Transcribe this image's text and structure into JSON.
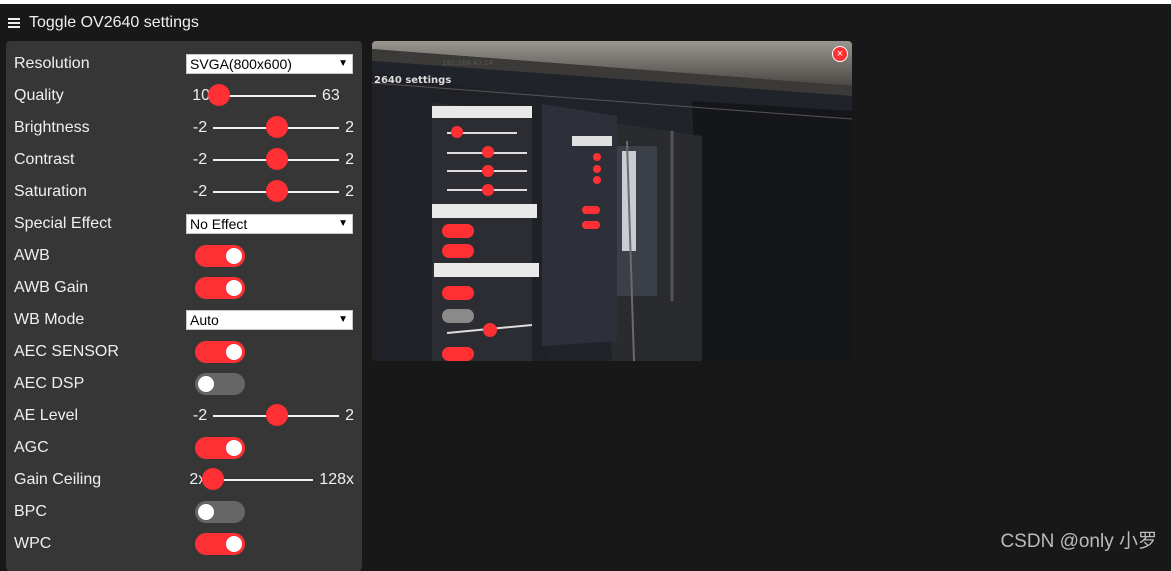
{
  "header": {
    "title": "Toggle OV2640 settings",
    "menu_icon": "hamburger-menu-icon"
  },
  "controls": {
    "resolution": {
      "label": "Resolution",
      "value": "SVGA(800x600)"
    },
    "quality": {
      "label": "Quality",
      "min": "10",
      "max": "63",
      "value": 10
    },
    "brightness": {
      "label": "Brightness",
      "min": "-2",
      "max": "2",
      "value": 0
    },
    "contrast": {
      "label": "Contrast",
      "min": "-2",
      "max": "2",
      "value": 0
    },
    "saturation": {
      "label": "Saturation",
      "min": "-2",
      "max": "2",
      "value": 0
    },
    "special_effect": {
      "label": "Special Effect",
      "value": "No Effect"
    },
    "awb": {
      "label": "AWB",
      "checked": true
    },
    "awb_gain": {
      "label": "AWB Gain",
      "checked": true
    },
    "wb_mode": {
      "label": "WB Mode",
      "value": "Auto"
    },
    "aec_sensor": {
      "label": "AEC SENSOR",
      "checked": true
    },
    "aec_dsp": {
      "label": "AEC DSP",
      "checked": false
    },
    "ae_level": {
      "label": "AE Level",
      "min": "-2",
      "max": "2",
      "value": 0
    },
    "agc": {
      "label": "AGC",
      "checked": true
    },
    "gain_ceiling": {
      "label": "Gain Ceiling",
      "min": "2x",
      "max": "128x",
      "value": 0
    },
    "bpc": {
      "label": "BPC",
      "checked": false
    },
    "wpc": {
      "label": "WPC",
      "checked": true
    }
  },
  "stream": {
    "close_symbol": "×",
    "screen_text": "2640 settings",
    "url_text": "192.168.43.14"
  },
  "colors": {
    "accent": "#ff3034",
    "panel": "#363636",
    "background": "#181818",
    "toggle_off": "#666666"
  },
  "watermark": "CSDN @only 小罗"
}
